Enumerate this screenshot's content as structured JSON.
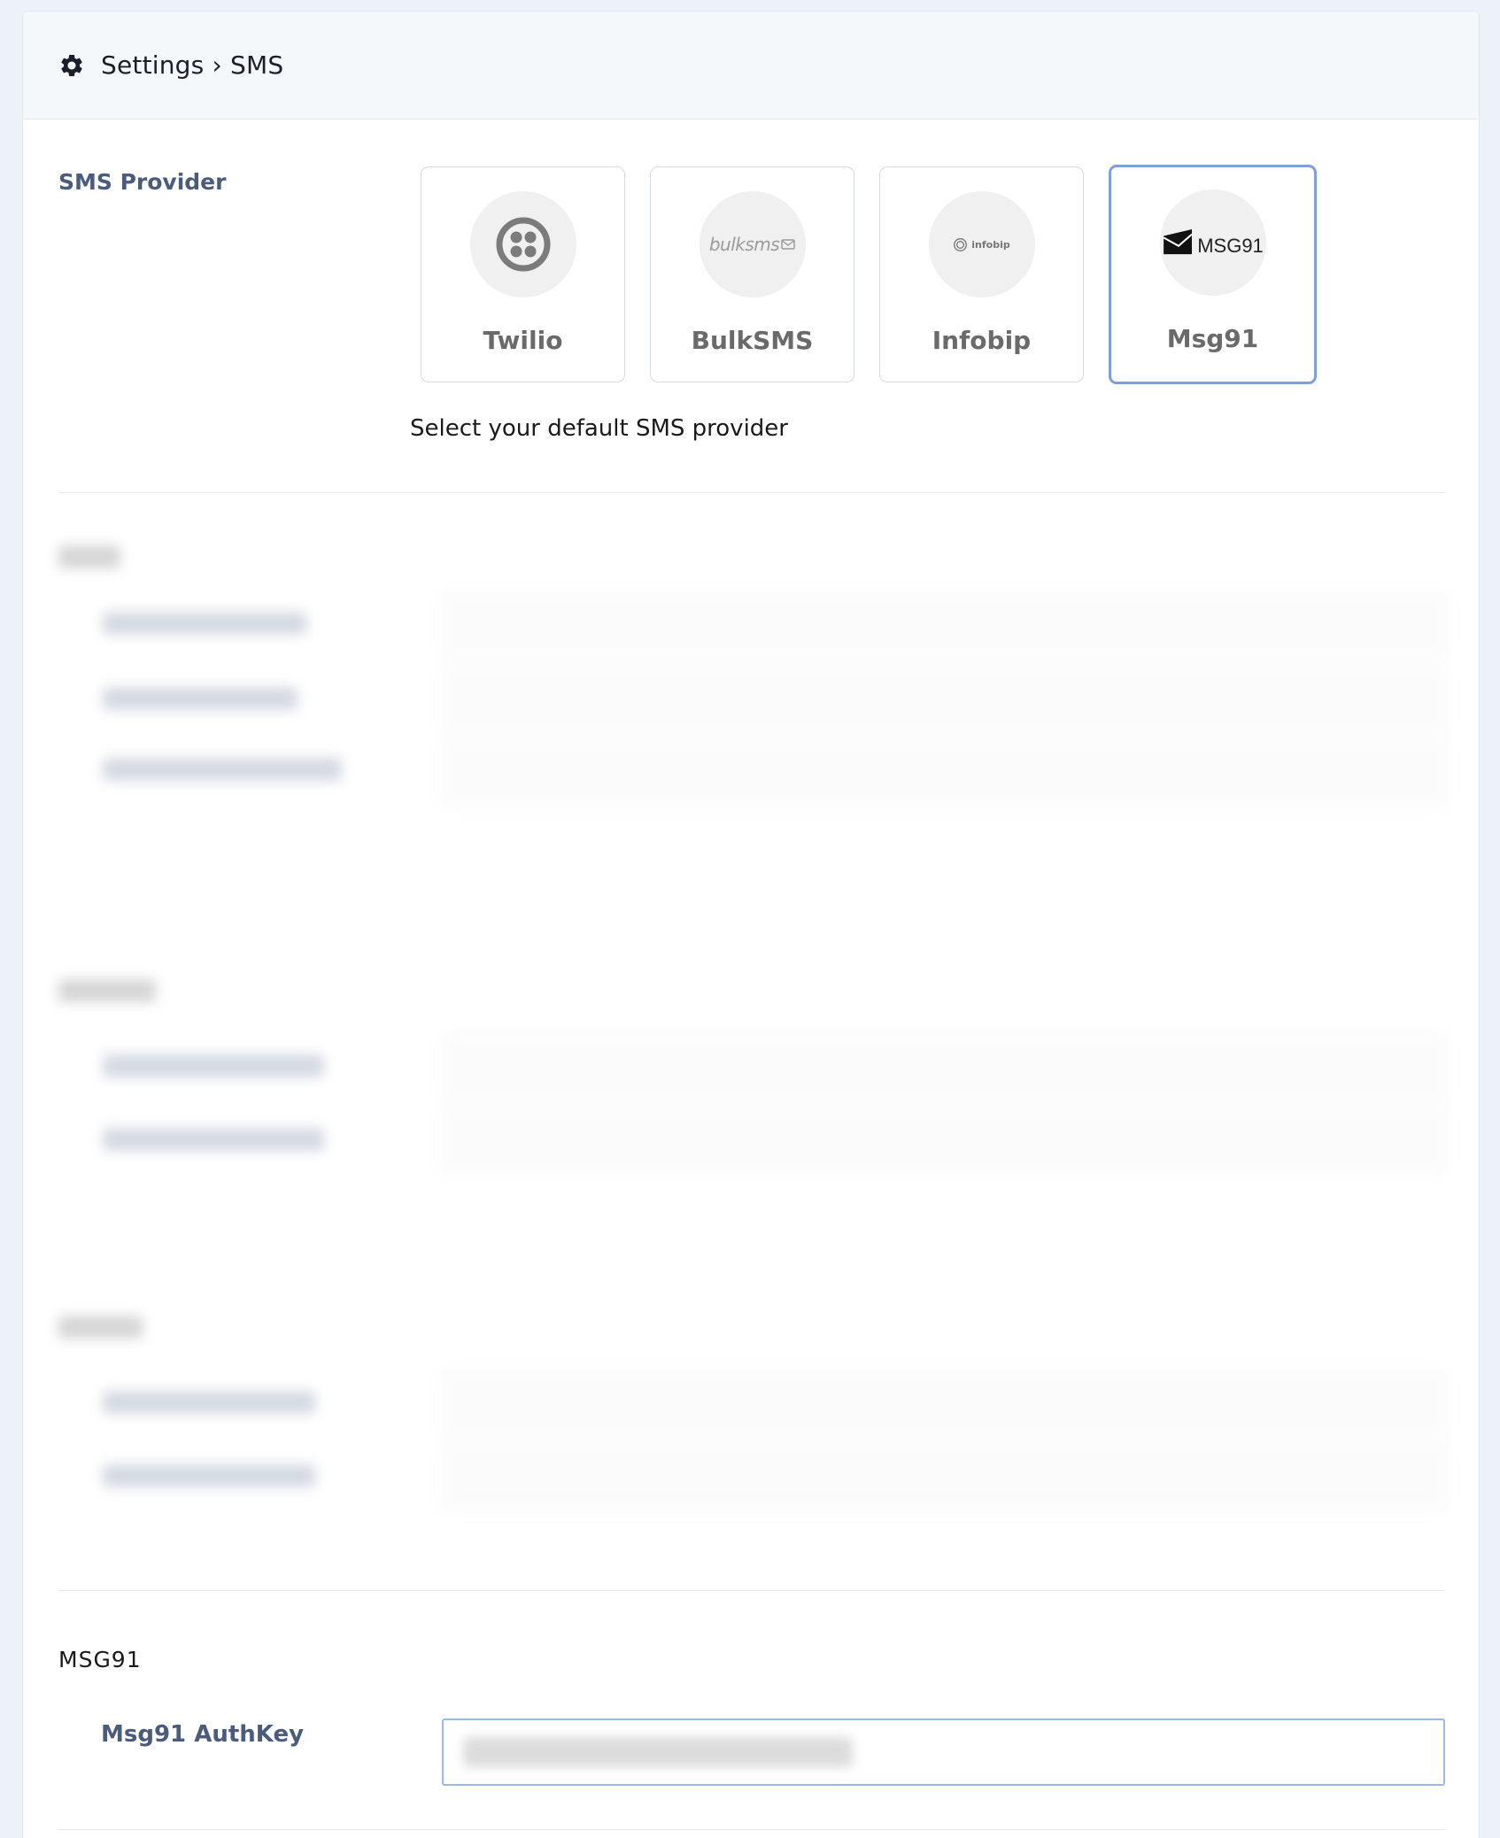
{
  "header": {
    "icon": "gear-icon",
    "title": "Settings › SMS"
  },
  "sms_provider": {
    "label": "SMS Provider",
    "helper_text": "Select your default SMS provider",
    "selected": "Msg91",
    "accent_color": "#7f9fdc",
    "providers": [
      {
        "name": "Twilio",
        "icon": "twilio-logo-icon"
      },
      {
        "name": "BulkSMS",
        "icon": "bulksms-logo-icon",
        "logo_text": "bulksms"
      },
      {
        "name": "Infobip",
        "icon": "infobip-logo-icon",
        "logo_text": "infobip"
      },
      {
        "name": "Msg91",
        "icon": "msg91-logo-icon",
        "logo_text": "MSG91"
      }
    ]
  },
  "msg91": {
    "section_title": "MSG91",
    "authkey_label": "Msg91 AuthKey"
  }
}
